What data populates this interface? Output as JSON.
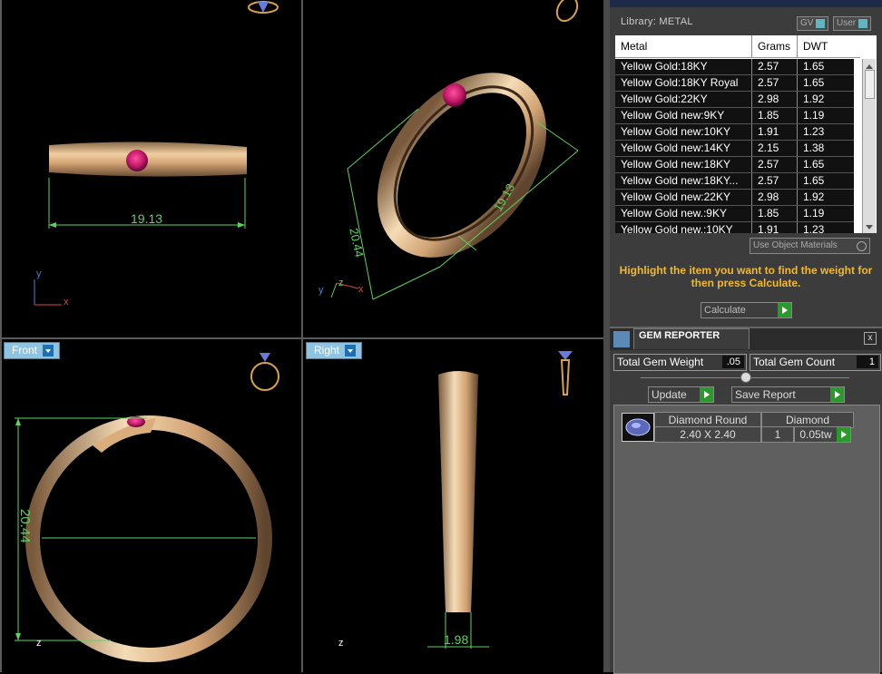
{
  "viewports": {
    "top": {
      "dimension": "19.13"
    },
    "perspective": {
      "dimension_a": "20.44",
      "dimension_b": "19.13"
    },
    "front": {
      "label": "Front",
      "dimension": "20.44"
    },
    "right": {
      "label": "Right",
      "dimension": "1.98"
    },
    "axis": {
      "x": "x",
      "y": "y",
      "z": "z"
    }
  },
  "library": {
    "title": "Library: METAL",
    "gv_label": "GV",
    "user_label": "User",
    "columns": [
      "Metal",
      "Grams",
      "DWT"
    ],
    "rows": [
      [
        "Yellow Gold:18KY",
        "2.57",
        "1.65"
      ],
      [
        "Yellow Gold:18KY Royal",
        "2.57",
        "1.65"
      ],
      [
        "Yellow Gold:22KY",
        "2.98",
        "1.92"
      ],
      [
        "Yellow Gold new:9KY",
        "1.85",
        "1.19"
      ],
      [
        "Yellow Gold new:10KY",
        "1.91",
        "1.23"
      ],
      [
        "Yellow Gold new:14KY",
        "2.15",
        "1.38"
      ],
      [
        "Yellow Gold new:18KY",
        "2.57",
        "1.65"
      ],
      [
        "Yellow Gold new:18KY...",
        "2.57",
        "1.65"
      ],
      [
        "Yellow Gold new:22KY",
        "2.98",
        "1.92"
      ],
      [
        "Yellow Gold new.:9KY",
        "1.85",
        "1.19"
      ],
      [
        "Yellow Gold new.:10KY",
        "1.91",
        "1.23"
      ]
    ],
    "use_object_materials": "Use Object Materials",
    "hint": "Highlight the item you want to find the weight for then press Calculate.",
    "calculate_label": "Calculate"
  },
  "gem_reporter": {
    "title": "GEM REPORTER",
    "close": "x",
    "total_weight_label": "Total Gem Weight",
    "total_weight_value": ".05",
    "total_count_label": "Total Gem Count",
    "total_count_value": "1",
    "update_label": "Update",
    "save_label": "Save Report",
    "gem": {
      "name": "Diamond Round",
      "size": "2.40 X 2.40",
      "type": "Diamond",
      "count": "1",
      "weight": "0.05tw"
    }
  },
  "colors": {
    "gold": "#d9ae7c",
    "gem": "#c4196a",
    "dimension": "#5ed35e",
    "hint": "#f2b92a"
  }
}
